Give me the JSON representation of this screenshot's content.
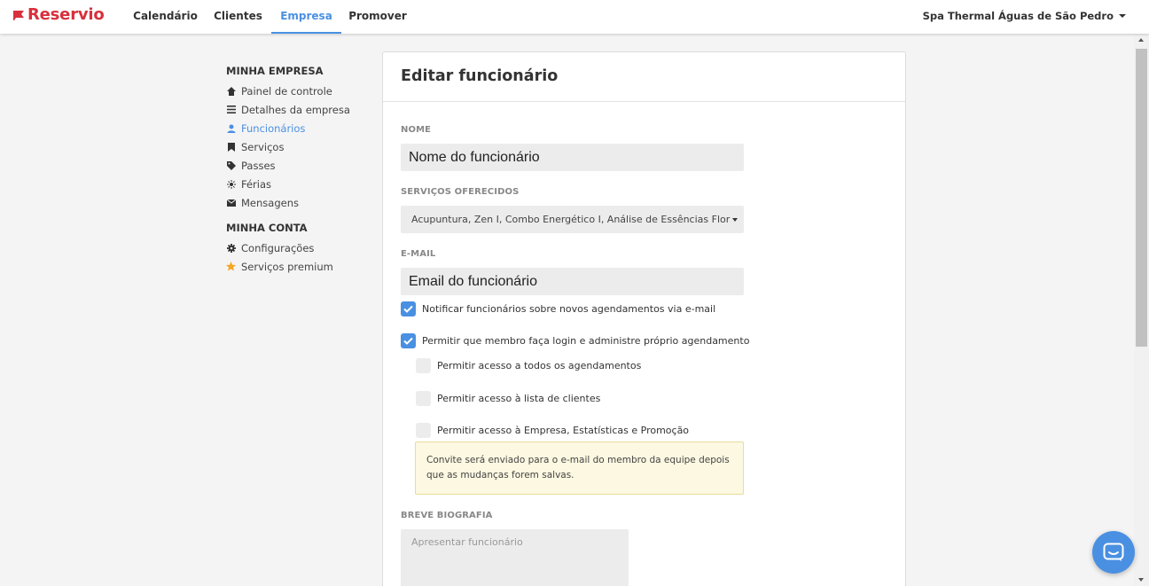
{
  "brand": {
    "name": "Reservio",
    "color": "#d8303c"
  },
  "nav": {
    "items": [
      {
        "label": "Calendário",
        "active": false
      },
      {
        "label": "Clientes",
        "active": false
      },
      {
        "label": "Empresa",
        "active": true
      },
      {
        "label": "Promover",
        "active": false
      }
    ],
    "account_label": "Spa Thermal Águas de São Pedro",
    "accent_color": "#4a90e2"
  },
  "sidebar": {
    "sections": [
      {
        "heading": "MINHA EMPRESA",
        "items": [
          {
            "label": "Painel de controle",
            "icon": "dashboard-icon",
            "active": false
          },
          {
            "label": "Detalhes da empresa",
            "icon": "list-icon",
            "active": false
          },
          {
            "label": "Funcionários",
            "icon": "user-icon",
            "active": true
          },
          {
            "label": "Serviços",
            "icon": "bookmark-icon",
            "active": false
          },
          {
            "label": "Passes",
            "icon": "tag-icon",
            "active": false
          },
          {
            "label": "Férias",
            "icon": "sun-icon",
            "active": false
          },
          {
            "label": "Mensagens",
            "icon": "envelope-icon",
            "active": false
          }
        ]
      },
      {
        "heading": "MINHA CONTA",
        "items": [
          {
            "label": "Configurações",
            "icon": "gear-icon",
            "active": false
          },
          {
            "label": "Serviços premium",
            "icon": "star-icon",
            "active": false
          }
        ]
      }
    ]
  },
  "form": {
    "title": "Editar funcionário",
    "name_label": "NOME",
    "name_placeholder": "Nome do funcionário",
    "services_label": "SERVIÇOS OFERECIDOS",
    "services_value": "Acupuntura, Zen I, Combo Energético I, Análise de Essências Florais, Combo",
    "email_label": "E-MAIL",
    "email_placeholder": "Email do funcionário",
    "checkboxes": [
      {
        "label": "Notificar funcionários sobre novos agendamentos via e-mail",
        "checked": true
      },
      {
        "label": "Permitir que membro faça login e administre próprio agendamento",
        "checked": true
      },
      {
        "label": "Permitir acesso a todos os agendamentos",
        "checked": false
      },
      {
        "label": "Permitir acesso à lista de clientes",
        "checked": false
      },
      {
        "label": "Permitir acesso à Empresa, Estatísticas e Promoção",
        "checked": false
      }
    ],
    "invite_notice": "Convite será enviado para o e-mail do membro da equipe depois que as mudanças forem salvas.",
    "bio_label": "BREVE BIOGRAFIA",
    "bio_placeholder": "Apresentar funcionário"
  }
}
